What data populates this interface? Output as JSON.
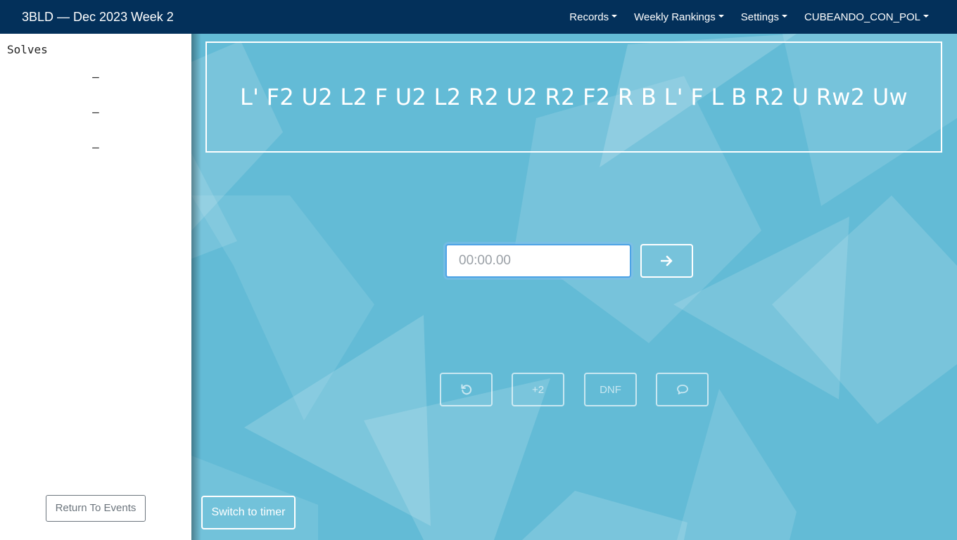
{
  "navbar": {
    "brand": "3BLD — Dec 2023 Week 2",
    "items": [
      {
        "label": "Records"
      },
      {
        "label": "Weekly Rankings"
      },
      {
        "label": "Settings"
      },
      {
        "label": "CUBEANDO_CON_POL"
      }
    ]
  },
  "sidebar": {
    "title": "Solves",
    "solves": [
      "—",
      "—",
      "—"
    ],
    "return_label": "Return To Events"
  },
  "main": {
    "scramble": "L' F2 U2 L2 F U2 L2 R2 U2 R2 F2 R B L' F L B R2 U Rw2 Uw",
    "time_placeholder": "00:00.00",
    "submit_icon": "arrow-right-icon",
    "penalty_buttons": [
      {
        "icon": "undo-icon",
        "label": ""
      },
      {
        "label": "+2"
      },
      {
        "label": "DNF"
      },
      {
        "icon": "comment-icon",
        "label": ""
      }
    ],
    "switch_label": "Switch to timer"
  },
  "colors": {
    "navbar": "#03305a",
    "background": "#63bbd6",
    "input_focus": "#4da3e6"
  }
}
